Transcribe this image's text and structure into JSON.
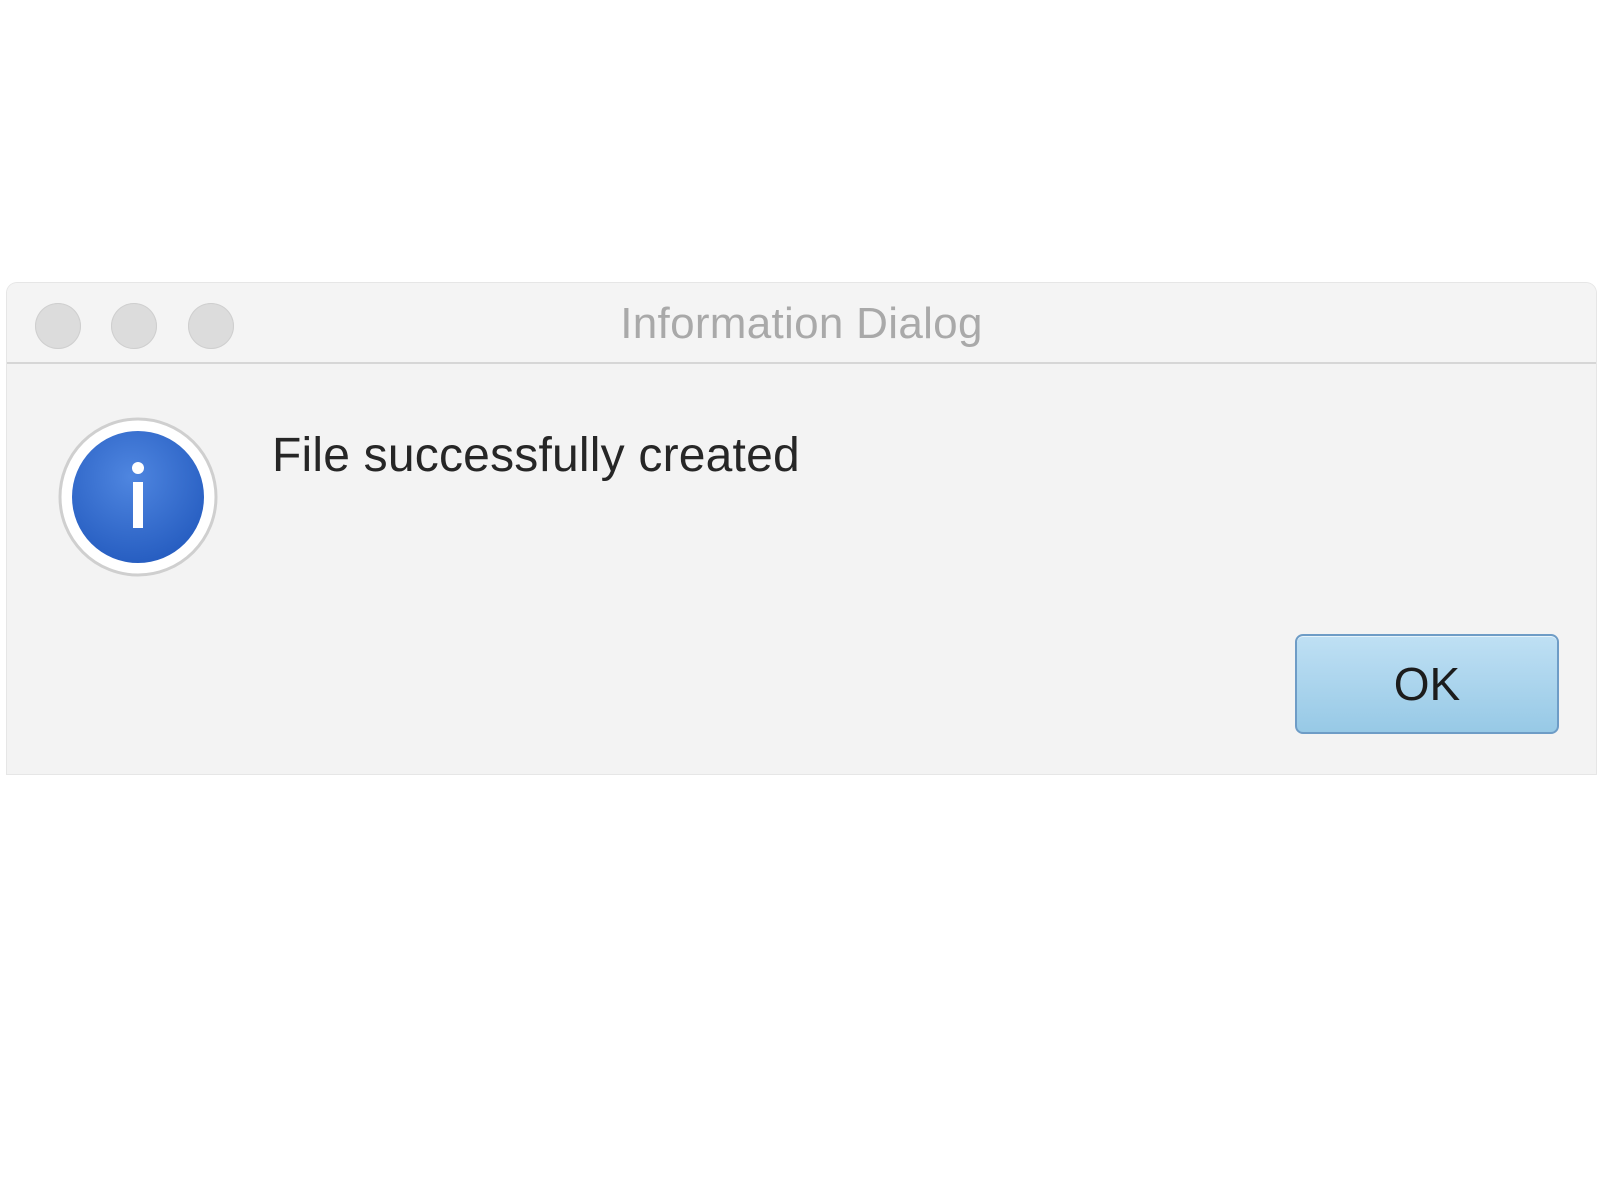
{
  "window": {
    "title": "Information Dialog"
  },
  "dialog": {
    "message": "File successfully created",
    "icon": "information-icon",
    "ok_label": "OK"
  },
  "colors": {
    "accent_button": "#a9d3ec",
    "info_icon_blue": "#2f63c8"
  }
}
